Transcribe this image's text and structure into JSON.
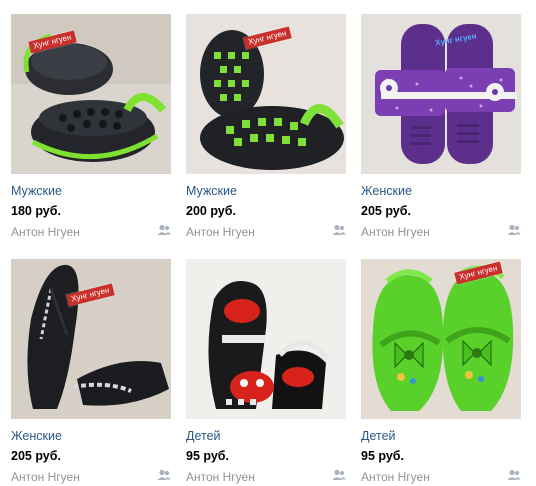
{
  "products": [
    {
      "category": "Мужские",
      "price": "180 руб.",
      "seller": "Антон Нгуен",
      "tag": "Хунг нгуен"
    },
    {
      "category": "Мужские",
      "price": "200 руб.",
      "seller": "Антон Нгуен",
      "tag": "Хунг нгуен"
    },
    {
      "category": "Женские",
      "price": "205 руб.",
      "seller": "Антон Нгуен",
      "tag": "Хунг нгуен"
    },
    {
      "category": "Женские",
      "price": "205 руб.",
      "seller": "Антон Нгуен",
      "tag": "Хунг нгуен"
    },
    {
      "category": "Детей",
      "price": "95 руб.",
      "seller": "Антон Нгуен",
      "tag": ""
    },
    {
      "category": "Детей",
      "price": "95 руб.",
      "seller": "Антон Нгуен",
      "tag": "Хунг нгуен"
    }
  ],
  "icons": {
    "seller_contacts": "users-icon"
  },
  "colors": {
    "link": "#2a5885",
    "muted": "#939393",
    "tag": "#c9302c"
  }
}
